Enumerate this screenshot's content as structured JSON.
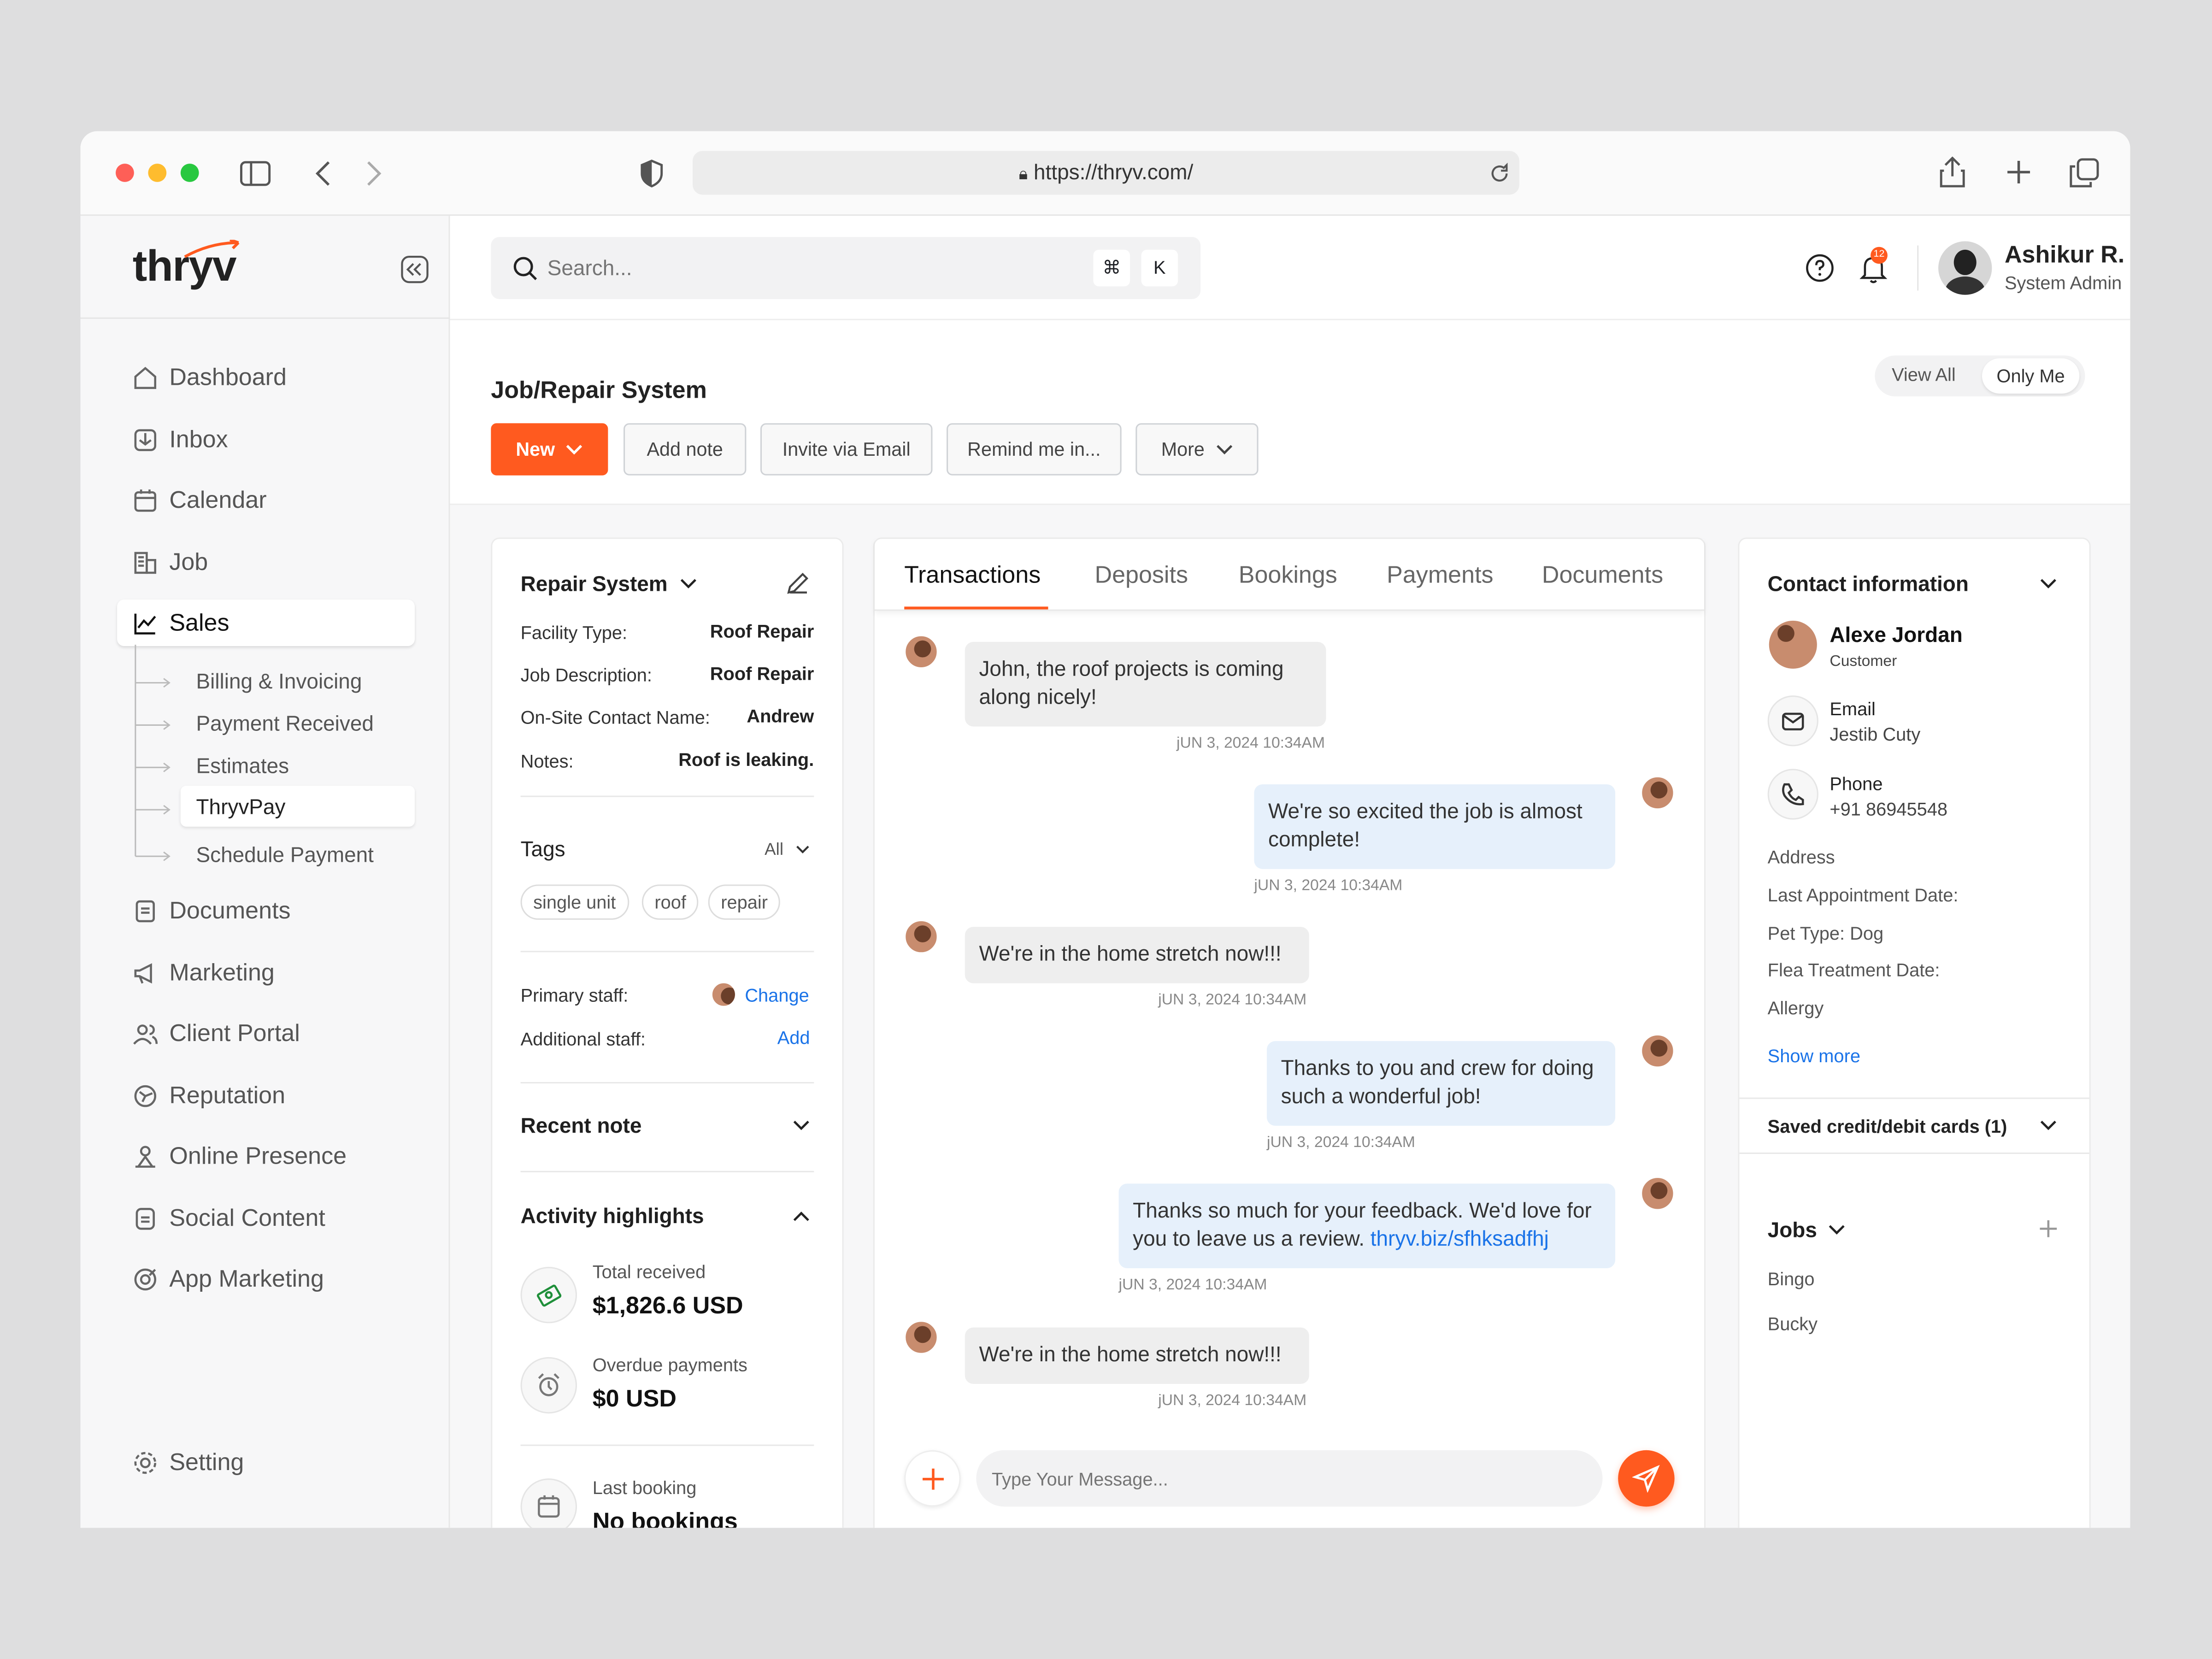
{
  "browser": {
    "url": "https://thryv.com/"
  },
  "brand": {
    "logo": "thryv",
    "accent": "#ff5a1f"
  },
  "sidebar": {
    "items": [
      {
        "label": "Dashboard",
        "icon": "home-icon"
      },
      {
        "label": "Inbox",
        "icon": "inbox-icon"
      },
      {
        "label": "Calendar",
        "icon": "calendar-icon"
      },
      {
        "label": "Job",
        "icon": "job-icon"
      },
      {
        "label": "Sales",
        "icon": "chart-icon"
      },
      {
        "label": "Documents",
        "icon": "document-icon"
      },
      {
        "label": "Marketing",
        "icon": "megaphone-icon"
      },
      {
        "label": "Client Portal",
        "icon": "users-icon"
      },
      {
        "label": "Reputation",
        "icon": "reputation-icon"
      },
      {
        "label": "Online Presence",
        "icon": "presence-icon"
      },
      {
        "label": "Social Content",
        "icon": "social-icon"
      },
      {
        "label": "App Marketing",
        "icon": "app-icon"
      }
    ],
    "sales_sub": [
      "Billing & Invoicing",
      "Payment Received",
      "Estimates",
      "ThryvPay",
      "Schedule Payment"
    ],
    "setting": "Setting"
  },
  "search": {
    "placeholder": "Search...",
    "k1": "⌘",
    "k2": "K"
  },
  "user": {
    "name": "Ashikur R.",
    "role": "System Admin",
    "badge": "12"
  },
  "header": {
    "title": "Job/Repair System",
    "view_all": "View All",
    "only_me": "Only Me",
    "actions": {
      "new": "New",
      "add_note": "Add note",
      "invite": "Invite via Email",
      "remind": "Remind me in...",
      "more": "More"
    }
  },
  "details": {
    "title": "Repair System",
    "fields": [
      {
        "k": "Facility Type:",
        "v": "Roof Repair"
      },
      {
        "k": "Job Description:",
        "v": "Roof Repair"
      },
      {
        "k": "On-Site Contact Name:",
        "v": "Andrew"
      },
      {
        "k": "Notes:",
        "v": "Roof is leaking."
      }
    ],
    "tags_title": "Tags",
    "tags_filter": "All",
    "tags": [
      "single unit",
      "roof",
      "repair"
    ],
    "primary_staff": "Primary staff:",
    "change": "Change",
    "additional_staff": "Additional staff:",
    "add": "Add",
    "recent_note": "Recent note",
    "activity": "Activity highlights",
    "total_received_label": "Total received",
    "total_received": "$1,826.6 USD",
    "overdue_label": "Overdue payments",
    "overdue": "$0 USD",
    "last_booking_label": "Last booking",
    "last_booking": "No bookings"
  },
  "tabs": [
    "Transactions",
    "Deposits",
    "Bookings",
    "Payments",
    "Documents"
  ],
  "messages": [
    {
      "text": "John, the roof projects is coming along nicely!",
      "time": "jUN 3, 2024 10:34AM"
    },
    {
      "text": "We're so excited the job is almost complete!",
      "time": "jUN 3, 2024 10:34AM"
    },
    {
      "text": "We're in the home stretch now!!!",
      "time": "jUN 3, 2024 10:34AM"
    },
    {
      "text": "Thanks to you and crew for doing such a wonderful job!",
      "time": "jUN 3, 2024 10:34AM"
    },
    {
      "text": "Thanks so much for your feedback. We'd love for you to leave us a review.",
      "link": "thryv.biz/sfhksadfhj",
      "time": "jUN 3, 2024 10:34AM"
    },
    {
      "text": "We're in the home stretch now!!!",
      "time": "jUN 3, 2024 10:34AM"
    }
  ],
  "composer": {
    "placeholder": "Type Your Message..."
  },
  "contact": {
    "title": "Contact information",
    "name": "Alexe Jordan",
    "role": "Customer",
    "email_label": "Email",
    "email": "Jestib Cuty",
    "phone_label": "Phone",
    "phone": "+91 86945548",
    "fields": [
      "Address",
      "Last Appointment Date:",
      "Pet Type: Dog",
      "Flea Treatment Date:",
      "Allergy"
    ],
    "show_more": "Show more",
    "cards": "Saved credit/debit cards (1)",
    "jobs_title": "Jobs",
    "jobs": [
      "Bingo",
      "Bucky"
    ]
  }
}
